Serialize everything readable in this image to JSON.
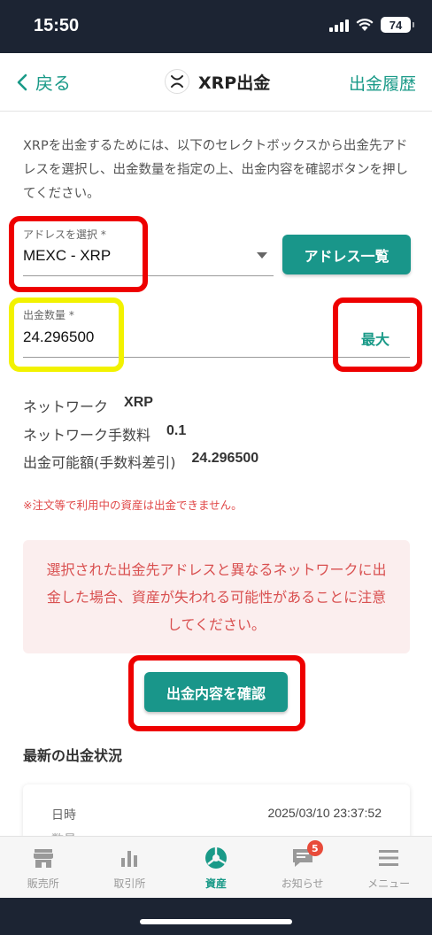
{
  "status": {
    "time": "15:50",
    "battery": "74"
  },
  "header": {
    "back_label": "戻る",
    "title": "XRP出金",
    "history_label": "出金履歴"
  },
  "description": "XRPを出金するためには、以下のセレクトボックスから出金先アドレスを選択し、出金数量を指定の上、出金内容を確認ボタンを押してください。",
  "address_select": {
    "label": "アドレスを選択 *",
    "value": "MEXC - XRP"
  },
  "address_list_button": "アドレス一覧",
  "amount_field": {
    "label": "出金数量 *",
    "value": "24.296500"
  },
  "max_label": "最大",
  "info": {
    "network_label": "ネットワーク",
    "network_value": "XRP",
    "fee_label": "ネットワーク手数料",
    "fee_value": "0.1",
    "available_label": "出金可能額(手数料差引)",
    "available_value": "24.296500"
  },
  "note": "※注文等で利用中の資産は出金できません。",
  "warning": "選択された出金先アドレスと異なるネットワークに出金した場合、資産が失われる可能性があることに注意してください。",
  "confirm_button": "出金内容を確認",
  "latest_section": {
    "title": "最新の出金状況",
    "date_label": "日時",
    "date_value": "2025/03/10 23:37:52",
    "next_label": "数量"
  },
  "tabs": [
    {
      "label": "販売所",
      "icon": "store-icon"
    },
    {
      "label": "取引所",
      "icon": "chart-icon"
    },
    {
      "label": "資産",
      "icon": "pie-chart-icon"
    },
    {
      "label": "お知らせ",
      "icon": "message-icon",
      "badge": "5"
    },
    {
      "label": "メニュー",
      "icon": "menu-icon"
    }
  ],
  "colors": {
    "accent": "#19968a",
    "warning_text": "#d95050",
    "warning_bg": "#fbeeee",
    "highlight_red": "#ee0000",
    "highlight_yellow": "#f2f200",
    "status_bar": "#1c2433"
  }
}
